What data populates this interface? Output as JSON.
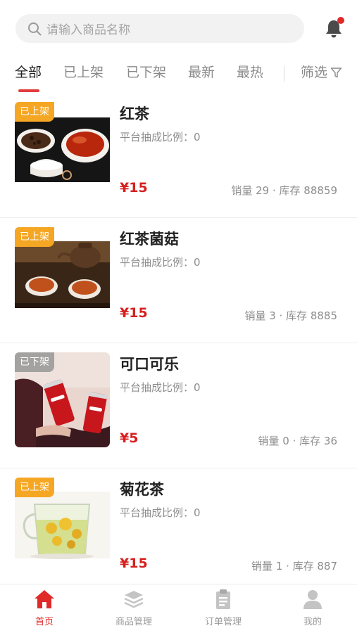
{
  "search": {
    "placeholder": "请输入商品名称"
  },
  "tabs": [
    "全部",
    "已上架",
    "已下架",
    "最新",
    "最热"
  ],
  "filter_label": "筛选",
  "products": [
    {
      "status": "已上架",
      "name": "红茶",
      "rate": "平台抽成比例：0",
      "price": "¥15",
      "stock": "销量 29 · 库存 88859"
    },
    {
      "status": "已上架",
      "name": "红茶菌菇",
      "rate": "平台抽成比例：0",
      "price": "¥15",
      "stock": "销量 3 · 库存 8885"
    },
    {
      "status": "已下架",
      "name": "可口可乐",
      "rate": "平台抽成比例：0",
      "price": "¥5",
      "stock": "销量 0 · 库存 36"
    },
    {
      "status": "已上架",
      "name": "菊花茶",
      "rate": "平台抽成比例：0",
      "price": "¥15",
      "stock": "销量 1 · 库存 887"
    }
  ],
  "nav": [
    {
      "label": "首页",
      "icon": "home-icon"
    },
    {
      "label": "商品管理",
      "icon": "layers-icon"
    },
    {
      "label": "订单管理",
      "icon": "clipboard-icon"
    },
    {
      "label": "我的",
      "icon": "user-icon"
    }
  ],
  "colors": {
    "accent": "#e02a2a",
    "badge_on": "#f5a623",
    "badge_off": "#969696"
  }
}
